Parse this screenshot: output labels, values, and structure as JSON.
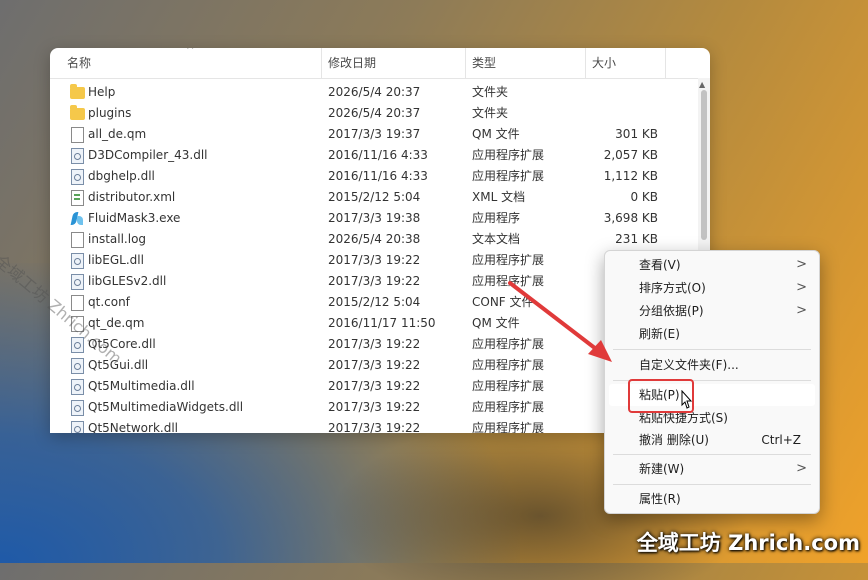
{
  "columns": {
    "name": "名称",
    "date": "修改日期",
    "type": "类型",
    "size": "大小"
  },
  "files": [
    {
      "icon": "folder-icon",
      "name": "Help",
      "date": "2026/5/4 20:37",
      "type": "文件夹",
      "size": ""
    },
    {
      "icon": "folder-icon",
      "name": "plugins",
      "date": "2026/5/4 20:37",
      "type": "文件夹",
      "size": ""
    },
    {
      "icon": "doc-icon",
      "name": "all_de.qm",
      "date": "2017/3/3 19:37",
      "type": "QM 文件",
      "size": "301 KB"
    },
    {
      "icon": "dll-icon",
      "name": "D3DCompiler_43.dll",
      "date": "2016/11/16 4:33",
      "type": "应用程序扩展",
      "size": "2,057 KB"
    },
    {
      "icon": "dll-icon",
      "name": "dbghelp.dll",
      "date": "2016/11/16 4:33",
      "type": "应用程序扩展",
      "size": "1,112 KB"
    },
    {
      "icon": "xml-icon",
      "name": "distributor.xml",
      "date": "2015/2/12 5:04",
      "type": "XML 文档",
      "size": "0 KB"
    },
    {
      "icon": "exe-icon",
      "name": "FluidMask3.exe",
      "date": "2017/3/3 19:38",
      "type": "应用程序",
      "size": "3,698 KB"
    },
    {
      "icon": "doc-icon",
      "name": "install.log",
      "date": "2026/5/4 20:38",
      "type": "文本文档",
      "size": "231 KB"
    },
    {
      "icon": "dll-icon",
      "name": "libEGL.dll",
      "date": "2017/3/3 19:22",
      "type": "应用程序扩展",
      "size": ""
    },
    {
      "icon": "dll-icon",
      "name": "libGLESv2.dll",
      "date": "2017/3/3 19:22",
      "type": "应用程序扩展",
      "size": ""
    },
    {
      "icon": "doc-icon",
      "name": "qt.conf",
      "date": "2015/2/12 5:04",
      "type": "CONF 文件",
      "size": ""
    },
    {
      "icon": "doc-icon",
      "name": "qt_de.qm",
      "date": "2016/11/17 11:50",
      "type": "QM 文件",
      "size": ""
    },
    {
      "icon": "dll-icon",
      "name": "Qt5Core.dll",
      "date": "2017/3/3 19:22",
      "type": "应用程序扩展",
      "size": ""
    },
    {
      "icon": "dll-icon",
      "name": "Qt5Gui.dll",
      "date": "2017/3/3 19:22",
      "type": "应用程序扩展",
      "size": ""
    },
    {
      "icon": "dll-icon",
      "name": "Qt5Multimedia.dll",
      "date": "2017/3/3 19:22",
      "type": "应用程序扩展",
      "size": ""
    },
    {
      "icon": "dll-icon",
      "name": "Qt5MultimediaWidgets.dll",
      "date": "2017/3/3 19:22",
      "type": "应用程序扩展",
      "size": ""
    },
    {
      "icon": "dll-icon",
      "name": "Qt5Network.dll",
      "date": "2017/3/3 19:22",
      "type": "应用程序扩展",
      "size": ""
    }
  ],
  "context_menu": {
    "view": "查看(V)",
    "sort": "排序方式(O)",
    "group": "分组依据(P)",
    "refresh": "刷新(E)",
    "customize": "自定义文件夹(F)...",
    "paste": "粘贴(P)",
    "paste_shortcut": "粘贴快捷方式(S)",
    "undo_delete": "撤消 删除(U)",
    "undo_shortcut": "Ctrl+Z",
    "new": "新建(W)",
    "properties": "属性(R)"
  },
  "watermark": {
    "main": "全域工坊 Zhrich.com",
    "diagonal": "全域工坊 Zhrich.com"
  },
  "colors": {
    "annotation": "#e03a3a",
    "folder": "#f5c84a"
  }
}
